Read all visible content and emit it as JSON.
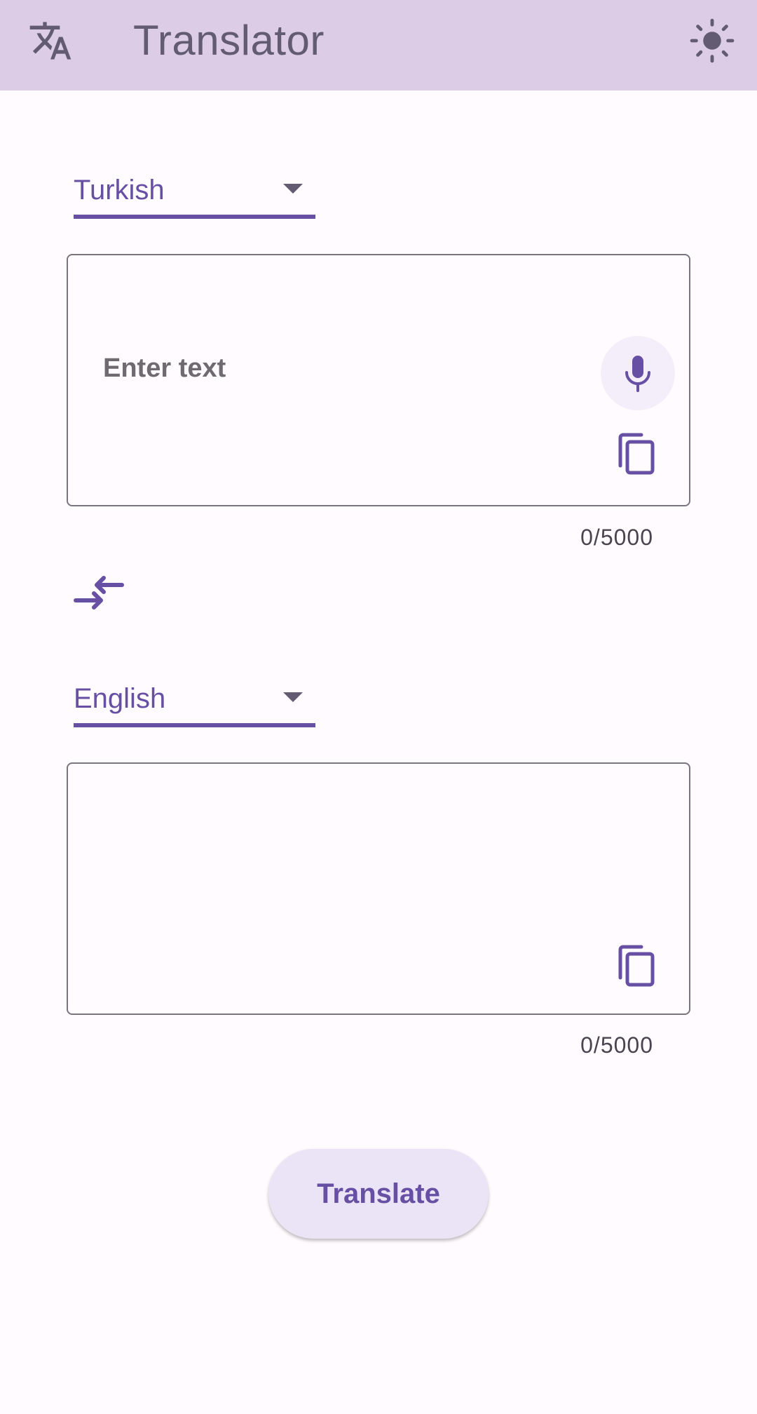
{
  "app_bar": {
    "title": "Translator",
    "leading_icon": "translate-icon",
    "trailing_icon": "brightness-icon"
  },
  "source": {
    "language": "Turkish",
    "placeholder": "Enter text",
    "char_count": "0/5000"
  },
  "target": {
    "language": "English",
    "char_count": "0/5000"
  },
  "actions": {
    "translate_label": "Translate"
  },
  "colors": {
    "appbar_bg": "#dccce5",
    "primary": "#6750a4",
    "on_surface_variant": "#625b71",
    "outline": "#79747e",
    "button_bg": "#ebe4f6"
  }
}
